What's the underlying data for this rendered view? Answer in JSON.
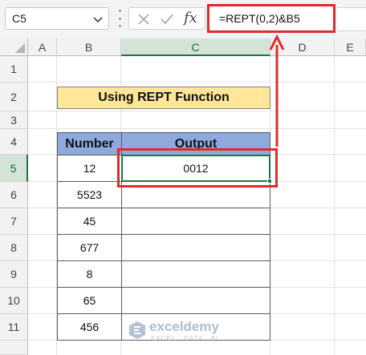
{
  "formula_bar": {
    "name_box": "C5",
    "fx_label": "fx",
    "formula": "=REPT(0,2)&B5"
  },
  "columns": [
    "A",
    "B",
    "C",
    "D",
    "E"
  ],
  "active_column": "C",
  "rows": [
    "1",
    "2",
    "3",
    "4",
    "5",
    "6",
    "7",
    "8",
    "9",
    "10",
    "11"
  ],
  "active_row": "5",
  "title": "Using REPT Function",
  "table": {
    "headers": [
      "Number",
      "Output"
    ],
    "rows": [
      {
        "number": "12",
        "output": "0012"
      },
      {
        "number": "5523",
        "output": ""
      },
      {
        "number": "45",
        "output": ""
      },
      {
        "number": "677",
        "output": ""
      },
      {
        "number": "8",
        "output": ""
      },
      {
        "number": "65",
        "output": ""
      },
      {
        "number": "456",
        "output": ""
      }
    ]
  },
  "watermark": {
    "name": "exceldemy",
    "tagline": "EXCEL · DATA · BI"
  },
  "colors": {
    "title_fill": "#ffe699",
    "header_fill": "#8ea9db",
    "highlight": "#e02b2b",
    "selection": "#217346"
  },
  "icons": {
    "name_box_dropdown": "chevron-down-icon",
    "cancel": "close-icon",
    "enter": "check-icon",
    "function": "fx-icon",
    "select_all": "select-all-triangle-icon",
    "watermark_logo": "exceldemy-logo-icon"
  }
}
